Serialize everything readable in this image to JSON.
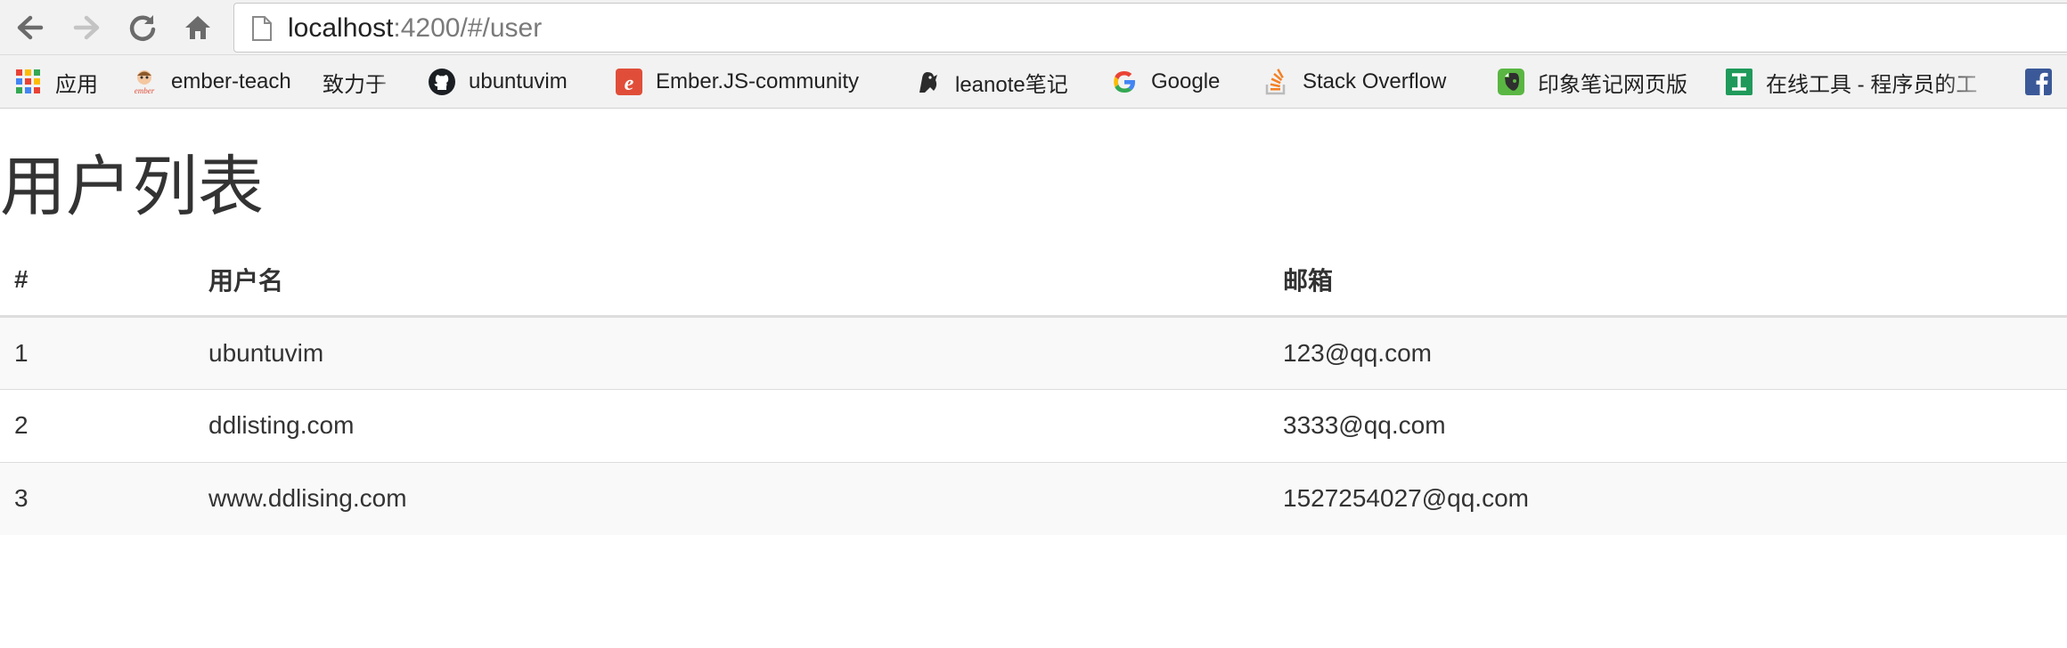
{
  "browser": {
    "url_host": "localhost",
    "url_path": ":4200/#/user"
  },
  "bookmarks": [
    {
      "label": "应用",
      "icon": "apps-grid-icon"
    },
    {
      "label": "ember-teach",
      "icon": "ember-teach-icon"
    },
    {
      "label": "致力于",
      "icon": ""
    },
    {
      "label": "ubuntuvim",
      "icon": "github-icon"
    },
    {
      "label": "Ember.JS-community",
      "icon": "ember-community-icon"
    },
    {
      "label": "leanote笔记",
      "icon": "leanote-icon"
    },
    {
      "label": "Google",
      "icon": "google-icon"
    },
    {
      "label": "Stack Overflow",
      "icon": "stackoverflow-icon"
    },
    {
      "label": "印象笔记网页版",
      "icon": "evernote-icon"
    },
    {
      "label": "在线工具 - 程序员的工",
      "icon": "online-tools-icon"
    },
    {
      "label": "",
      "icon": "facebook-icon"
    }
  ],
  "page": {
    "title": "用户列表",
    "table": {
      "headers": [
        "#",
        "用户名",
        "邮箱"
      ],
      "rows": [
        {
          "id": "1",
          "username": "ubuntuvim",
          "email": "123@qq.com"
        },
        {
          "id": "2",
          "username": "ddlisting.com",
          "email": "3333@qq.com"
        },
        {
          "id": "3",
          "username": "www.ddlising.com",
          "email": "1527254027@qq.com"
        }
      ]
    }
  },
  "colors": {
    "toolbar_bg": "#f2f2f2",
    "text": "#333333",
    "row_stripe": "#f9f9f9",
    "border": "#dddddd"
  }
}
